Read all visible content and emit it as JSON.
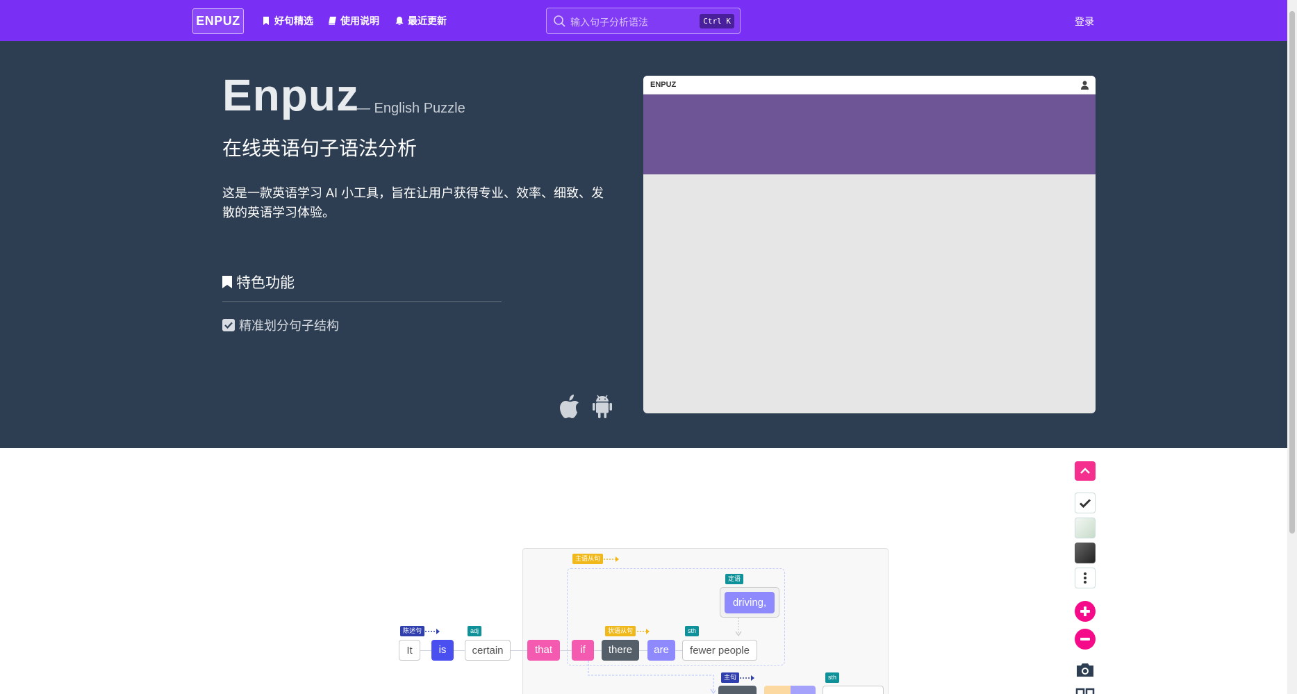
{
  "nav": {
    "logo": "ENPUZ",
    "links": [
      "好句精选",
      "使用说明",
      "最近更新"
    ],
    "search_placeholder": "输入句子分析语法",
    "search_shortcut": "Ctrl K",
    "login": "登录"
  },
  "hero": {
    "brand": "Enpuz",
    "brand_sub": "— English Puzzle",
    "subtitle": "在线英语句子语法分析",
    "description": "这是一款英语学习 AI 小工具，旨在让用户获得专业、效率、细致、发散的英语学习体验。",
    "features_heading": "特色功能",
    "feature_item": "精准划分句子结构",
    "preview_title": "ENPUZ"
  },
  "diagram": {
    "words": [
      "It",
      "is",
      "certain",
      "that",
      "if",
      "there",
      "are",
      "fewer people",
      "driving,"
    ],
    "tags": {
      "declarative": "陈述句",
      "adj": "adj",
      "subject_clause": "主语从句",
      "adverbial_clause": "状语从句",
      "sth": "sth",
      "attributive": "定语",
      "main_clause": "主句",
      "sth2": "sth"
    }
  },
  "colors": {
    "nav_bg": "#7a2ff5",
    "hero_bg": "#2e3e52",
    "accent_pink": "#f50a8a"
  }
}
